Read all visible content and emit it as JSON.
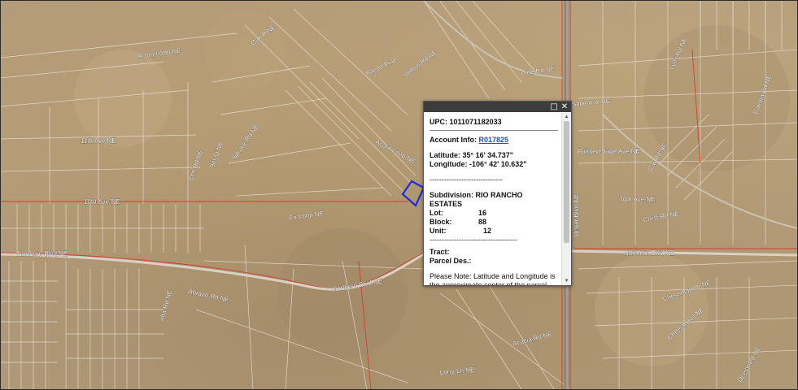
{
  "popup": {
    "maximize_icon": "maximize-icon",
    "close_icon": "close-icon",
    "upc_label": "UPC:",
    "upc_value": "1011071182033",
    "account_label": "Account Info:",
    "account_value": "R017825",
    "latitude_label": "Latitude:",
    "latitude_value": "35° 16' 34.737\"",
    "longitude_label": "Longitude:",
    "longitude_value": "-106° 42' 10.632\"",
    "dashes": "------------------------------",
    "subdivision_label": "Subdivision:",
    "subdivision_value": "RIO RANCHO ESTATES",
    "lot_label": "Lot:",
    "lot_value": "16",
    "block_label": "Block:",
    "block_value": "88",
    "unit_label": "Unit:",
    "unit_value": "12",
    "dashes2": "------------------------------------",
    "tract_label": "Tract:",
    "tract_value": "",
    "parcel_label": "Parcel Des.:",
    "parcel_value": "",
    "note": "Please Note: Latitude and Longitude is the approximate center of the parcel shown."
  },
  "roads": {
    "oak_pine": "Oak PINE",
    "acorn_loop": "Acorn Loop NE",
    "acorn_loop_2": "Acorn Loop NE",
    "bacon_pine": "Bacon Pine",
    "willow": "Willow Rd NE",
    "pine_rd": "Pine Rd NE",
    "sage": "Sage Ave NE",
    "ave_11": "11th Ave NE",
    "spruce": "Spruce Rd NE",
    "elm": "Elm Rd NE",
    "ninth": "9th St NE",
    "ave_10": "10th Ave NE",
    "ave_10_right": "10th Ave NE",
    "fir_loop": "Fir Loop NE",
    "northern": "Northern Blvd NE",
    "northern_mid": "Northern Blvd NE",
    "northern_right": "Northern Blvd NE",
    "painted_sage": "Painted Sage Ave NE",
    "cat_rd": "Cat Rd NE",
    "lynx": "Lynx Rd NE",
    "abrazo": "Abrazo Rd NE",
    "alta": "Alta Rd NE",
    "acacia": "Acacia Rd NE",
    "lorry": "Lorry Ln NE",
    "unser": "Unser Blvd NE",
    "crest": "Crest Rd NE",
    "chessman": "Chessman Dr NE",
    "cheetah": "Cheetah Rd NE",
    "dakota": "Dakota Rd NE",
    "ocelot": "Ocelot Rd NE"
  }
}
